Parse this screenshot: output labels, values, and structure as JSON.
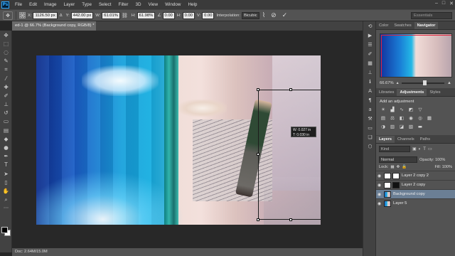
{
  "app": {
    "logo": "Ps",
    "menu": [
      "File",
      "Edit",
      "Image",
      "Layer",
      "Type",
      "Select",
      "Filter",
      "3D",
      "View",
      "Window",
      "Help"
    ]
  },
  "options": {
    "x_label": "X:",
    "x_value": "1126.50 px",
    "y_label": "Y:",
    "y_value": "442.00 px",
    "w_label": "W:",
    "w_value": "61.01%",
    "h_label": "H:",
    "h_value": "61.98%",
    "angle_value": "0.00",
    "h_skew_label": "H:",
    "h_skew_value": "0.00",
    "v_skew_label": "V:",
    "v_skew_value": "0.00",
    "interpolation_label": "Interpolation:",
    "interpolation_value": "Bicubic",
    "workspace": "Essentials"
  },
  "document": {
    "tab_title": "ed-1 @ 66.7% (Background copy, RGB/8) *",
    "status": "Doc: 2.64M/15.0M"
  },
  "transform_info": {
    "line1": "W: 0.027 in",
    "line2": "T: 0.030 in"
  },
  "panels": {
    "top_tabs": [
      "Color",
      "Swatches",
      "Navigator"
    ],
    "zoom": "66.67%",
    "mid_tabs": [
      "Libraries",
      "Adjustments",
      "Styles"
    ],
    "adjustments_title": "Add an adjustment",
    "layer_tabs": [
      "Layers",
      "Channels",
      "Paths"
    ],
    "layer_kind": "Kind",
    "blend_mode": "Normal",
    "opacity_label": "Opacity: 100%",
    "lock_label": "Lock:",
    "fill_label": "Fill: 100%",
    "layers": [
      {
        "name": "Layer 2 copy 2",
        "selected": false,
        "thumb": "white"
      },
      {
        "name": "Layer 2 copy",
        "selected": false,
        "thumb": "black"
      },
      {
        "name": "Background copy",
        "selected": true,
        "thumb": "photo"
      },
      {
        "name": "Layer 5",
        "selected": false,
        "thumb": "white"
      }
    ]
  },
  "colors": {
    "accent": "#31a8ff",
    "navigator_frame": "#e0223a",
    "selected_layer": "#6b7f95"
  }
}
